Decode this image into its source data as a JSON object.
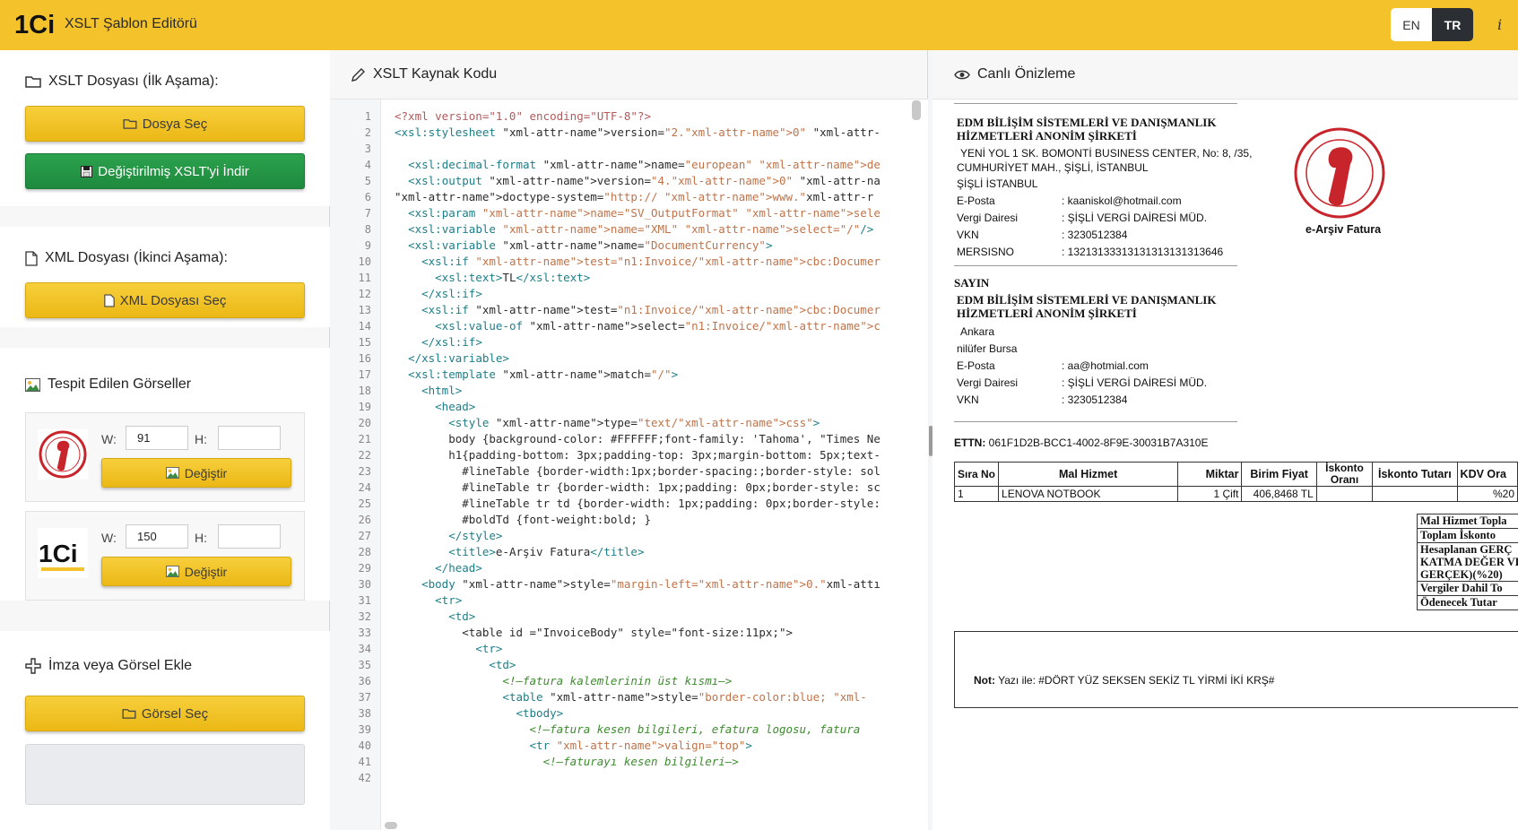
{
  "header": {
    "logo_text": "1Ci",
    "app_title": "XSLT Şablon Editörü",
    "lang_en": "EN",
    "lang_tr": "TR",
    "info_glyph": "i",
    "accent_color": "#f4c22b"
  },
  "sidebar": {
    "xslt_section": {
      "title": "XSLT Dosyası (İlk Aşama):",
      "choose_file_label": "Dosya Seç",
      "download_label": "Değiştirilmiş XSLT'yi İndir"
    },
    "xml_section": {
      "title": "XML Dosyası (İkinci Aşama):",
      "choose_xml_label": "XML Dosyası Seç"
    },
    "images_section": {
      "title": "Tespit Edilen Görseller",
      "images": [
        {
          "name": "maliye-seal",
          "w_label": "W:",
          "w_value": "91",
          "h_label": "H:",
          "h_value": "",
          "change_label": "Değiştir"
        },
        {
          "name": "1ci-logo",
          "w_label": "W:",
          "w_value": "150",
          "h_label": "H:",
          "h_value": "",
          "change_label": "Değiştir"
        }
      ]
    },
    "signature_section": {
      "title": "İmza veya Görsel Ekle",
      "choose_image_label": "Görsel Seç"
    }
  },
  "editor": {
    "title": "XSLT Kaynak Kodu",
    "lines": [
      [
        [
          "pi",
          "<?xml version=\"1.0\" encoding=\"UTF-8\"?>"
        ]
      ],
      [
        [
          "tag",
          "<xsl:stylesheet "
        ],
        [
          "txt",
          "\"xml-attr-name\">version="
        ],
        [
          "str",
          "\"2.\"xml-attr-name\">0\""
        ],
        [
          "txt",
          " \"xml-attr-"
        ]
      ],
      [
        [
          "txt",
          ""
        ]
      ],
      [
        [
          "txt",
          "  "
        ],
        [
          "tag",
          "<xsl:decimal-format "
        ],
        [
          "txt",
          "\"xml-attr-name\">name="
        ],
        [
          "str",
          "\"european\" \"xml-attr-name\">de"
        ]
      ],
      [
        [
          "txt",
          "  "
        ],
        [
          "tag",
          "<xsl:output "
        ],
        [
          "txt",
          "\"xml-attr-name\">version="
        ],
        [
          "str",
          "\"4.\"xml-attr-name\">0\""
        ],
        [
          "txt",
          " \"xml-attr-na"
        ]
      ],
      [
        [
          "txt",
          "\"xml-attr-name\">doctype-system="
        ],
        [
          "str",
          "\"http:// \"xml-attr-name\">www.\""
        ],
        [
          "txt",
          "xml-attr-r"
        ]
      ],
      [
        [
          "txt",
          "  "
        ],
        [
          "tag",
          "<xsl:param "
        ],
        [
          "str",
          "\"xml-attr-name\">name=\"SV_OutputFormat\" \"xml-attr-name\">sele"
        ]
      ],
      [
        [
          "txt",
          "  "
        ],
        [
          "tag",
          "<xsl:variable "
        ],
        [
          "str",
          "\"xml-attr-name\">name=\"XML\" \"xml-attr-name\">select=\"/\""
        ],
        [
          "tag",
          "/>"
        ]
      ],
      [
        [
          "txt",
          "  "
        ],
        [
          "tag",
          "<xsl:variable "
        ],
        [
          "txt",
          "\"xml-attr-name\">name="
        ],
        [
          "str",
          "\"DocumentCurrency\""
        ],
        [
          "tag",
          ">"
        ]
      ],
      [
        [
          "txt",
          "    "
        ],
        [
          "tag",
          "<xsl:if "
        ],
        [
          "str",
          "\"xml-attr-name\">test=\"n1:Invoice/\"xml-attr-name\">cbc:Documer"
        ]
      ],
      [
        [
          "txt",
          "      "
        ],
        [
          "tag",
          "<xsl:text>"
        ],
        [
          "txt",
          "TL"
        ],
        [
          "tag",
          "</xsl:text>"
        ]
      ],
      [
        [
          "txt",
          "    "
        ],
        [
          "tag",
          "</xsl:if>"
        ]
      ],
      [
        [
          "txt",
          "    "
        ],
        [
          "tag",
          "<xsl:if "
        ],
        [
          "txt",
          "\"xml-attr-name\">test="
        ],
        [
          "str",
          "\"n1:Invoice/\"xml-attr-name\">cbc:Documer"
        ]
      ],
      [
        [
          "txt",
          "      "
        ],
        [
          "tag",
          "<xsl:value-of "
        ],
        [
          "txt",
          "\"xml-attr-name\">select="
        ],
        [
          "str",
          "\"n1:Invoice/\"xml-attr-name\">c"
        ]
      ],
      [
        [
          "txt",
          "    "
        ],
        [
          "tag",
          "</xsl:if>"
        ]
      ],
      [
        [
          "txt",
          "  "
        ],
        [
          "tag",
          "</xsl:variable>"
        ]
      ],
      [
        [
          "txt",
          "  "
        ],
        [
          "tag",
          "<xsl:template "
        ],
        [
          "txt",
          "\"xml-attr-name\">match="
        ],
        [
          "str",
          "\"/\""
        ],
        [
          "tag",
          ">"
        ]
      ],
      [
        [
          "txt",
          "    "
        ],
        [
          "tag",
          "<html>"
        ]
      ],
      [
        [
          "txt",
          "      "
        ],
        [
          "tag",
          "<head>"
        ]
      ],
      [
        [
          "txt",
          "        "
        ],
        [
          "tag",
          "<style "
        ],
        [
          "txt",
          "\"xml-attr-name\">type="
        ],
        [
          "str",
          "\"text/\"xml-attr-name\">css\""
        ],
        [
          "tag",
          ">"
        ]
      ],
      [
        [
          "txt",
          "        body {background-color: #FFFFFF;font-family: 'Tahoma', \"Times Ne"
        ]
      ],
      [
        [
          "txt",
          "        h1{padding-bottom: 3px;padding-top: 3px;margin-bottom: 5px;text-"
        ]
      ],
      [
        [
          "txt",
          "          #lineTable {border-width:1px;border-spacing:;border-style: sol"
        ]
      ],
      [
        [
          "txt",
          "          #lineTable tr {border-width: 1px;padding: 0px;border-style: sc"
        ]
      ],
      [
        [
          "txt",
          "          #lineTable tr td {border-width: 1px;padding: 0px;border-style:"
        ]
      ],
      [
        [
          "txt",
          "          #boldTd {font-weight:bold; }"
        ]
      ],
      [
        [
          "txt",
          "        "
        ],
        [
          "tag",
          "</style>"
        ]
      ],
      [
        [
          "txt",
          "        "
        ],
        [
          "tag",
          "<title>"
        ],
        [
          "txt",
          "e-Arşiv Fatura"
        ],
        [
          "tag",
          "</title>"
        ]
      ],
      [
        [
          "txt",
          "      "
        ],
        [
          "tag",
          "</head>"
        ]
      ],
      [
        [
          "txt",
          "    "
        ],
        [
          "tag",
          "<body "
        ],
        [
          "txt",
          "\"xml-attr-name\">style="
        ],
        [
          "str",
          "\"margin-left=\"xml-attr-name\">0.\""
        ],
        [
          "txt",
          "xml-attı"
        ]
      ],
      [
        [
          "txt",
          "      "
        ],
        [
          "tag",
          "<tr>"
        ]
      ],
      [
        [
          "txt",
          "        "
        ],
        [
          "tag",
          "<td>"
        ]
      ],
      [
        [
          "txt",
          "          <table id =\"InvoiceBody\" style=\"font-size:11px;\">"
        ]
      ],
      [
        [
          "txt",
          "            "
        ],
        [
          "tag",
          "<tr>"
        ]
      ],
      [
        [
          "txt",
          "              "
        ],
        [
          "tag",
          "<td>"
        ]
      ],
      [
        [
          "txt",
          "                "
        ],
        [
          "cmt",
          "<!—fatura kalemlerinin üst kısmı—>"
        ]
      ],
      [
        [
          "txt",
          "                "
        ],
        [
          "tag",
          "<table "
        ],
        [
          "txt",
          "\"xml-attr-name\">style="
        ],
        [
          "str",
          "\"border-color:blue; \"xml-"
        ]
      ],
      [
        [
          "txt",
          "                  "
        ],
        [
          "tag",
          "<tbody>"
        ]
      ],
      [
        [
          "txt",
          "                    "
        ],
        [
          "cmt",
          "<!—fatura kesen bilgileri, efatura logosu, fatura"
        ]
      ],
      [
        [
          "txt",
          "                    "
        ],
        [
          "tag",
          "<tr "
        ],
        [
          "str",
          "\"xml-attr-name\">valign=\"top\""
        ],
        [
          "tag",
          ">"
        ]
      ],
      [
        [
          "txt",
          "                      "
        ],
        [
          "cmt",
          "<!—faturayı kesen bilgileri—>"
        ]
      ],
      [
        [
          "txt",
          ""
        ]
      ]
    ]
  },
  "preview": {
    "title": "Canlı Önizleme",
    "seller": {
      "name_line1": "EDM BİLİŞİM SİSTEMLERİ VE DANIŞMANLIK",
      "name_line2": "HİZMETLERİ ANONİM ŞİRKETİ",
      "address_line1": "YENİ YOL 1 SK. BOMONTİ BUSINESS CENTER, No: 8, /35,",
      "address_line2": "CUMHURİYET MAH., ŞİŞLİ, İSTANBUL",
      "address_line3": "ŞİŞLİ İSTANBUL",
      "fields": [
        {
          "label": "E-Posta",
          "value": ": kaaniskol@hotmail.com"
        },
        {
          "label": "Vergi Dairesi",
          "value": ": ŞİŞLİ VERGİ DAİRESİ MÜD."
        },
        {
          "label": "VKN",
          "value": ": 3230512384"
        },
        {
          "label": "MERSISNO",
          "value": ": 13213133313131313131313646"
        }
      ]
    },
    "seal_caption": "e-Arşiv Fatura",
    "buyer": {
      "heading": "SAYIN",
      "name_line1": "EDM BİLİŞİM SİSTEMLERİ VE DANIŞMANLIK",
      "name_line2": "HİZMETLERİ ANONİM ŞİRKETİ",
      "address_line1": "Ankara",
      "address_line2": "nilüfer Bursa",
      "fields": [
        {
          "label": "E-Posta",
          "value": ": aa@hotmial.com"
        },
        {
          "label": "Vergi Dairesi",
          "value": ": ŞİŞLİ VERGİ DAİRESİ MÜD."
        },
        {
          "label": "VKN",
          "value": ": 3230512384"
        }
      ]
    },
    "ettn_label": "ETTN:",
    "ettn_value": "061F1D2B-BCC1-4002-8F9E-30031B7A310E",
    "table": {
      "headers": [
        "Sıra No",
        "Mal Hizmet",
        "Miktar",
        "Birim Fiyat",
        "İskonto Oranı",
        "İskonto Tutarı",
        "KDV Ora"
      ],
      "rows": [
        [
          "1",
          "LENOVA NOTBOOK",
          "1 Çift",
          "406,8468 TL",
          "",
          "",
          "%20"
        ]
      ]
    },
    "totals": [
      "Mal Hizmet Topla",
      "Toplam İskonto",
      "Hesaplanan GERÇ",
      "KATMA DEĞER VE",
      "GERÇEK)(%20)",
      "Vergiler Dahil To",
      "Ödenecek Tutar"
    ],
    "note_label": "Not:",
    "note_text": "Yazı ile: #DÖRT YÜZ SEKSEN SEKİZ TL YİRMİ İKİ KRŞ#"
  }
}
